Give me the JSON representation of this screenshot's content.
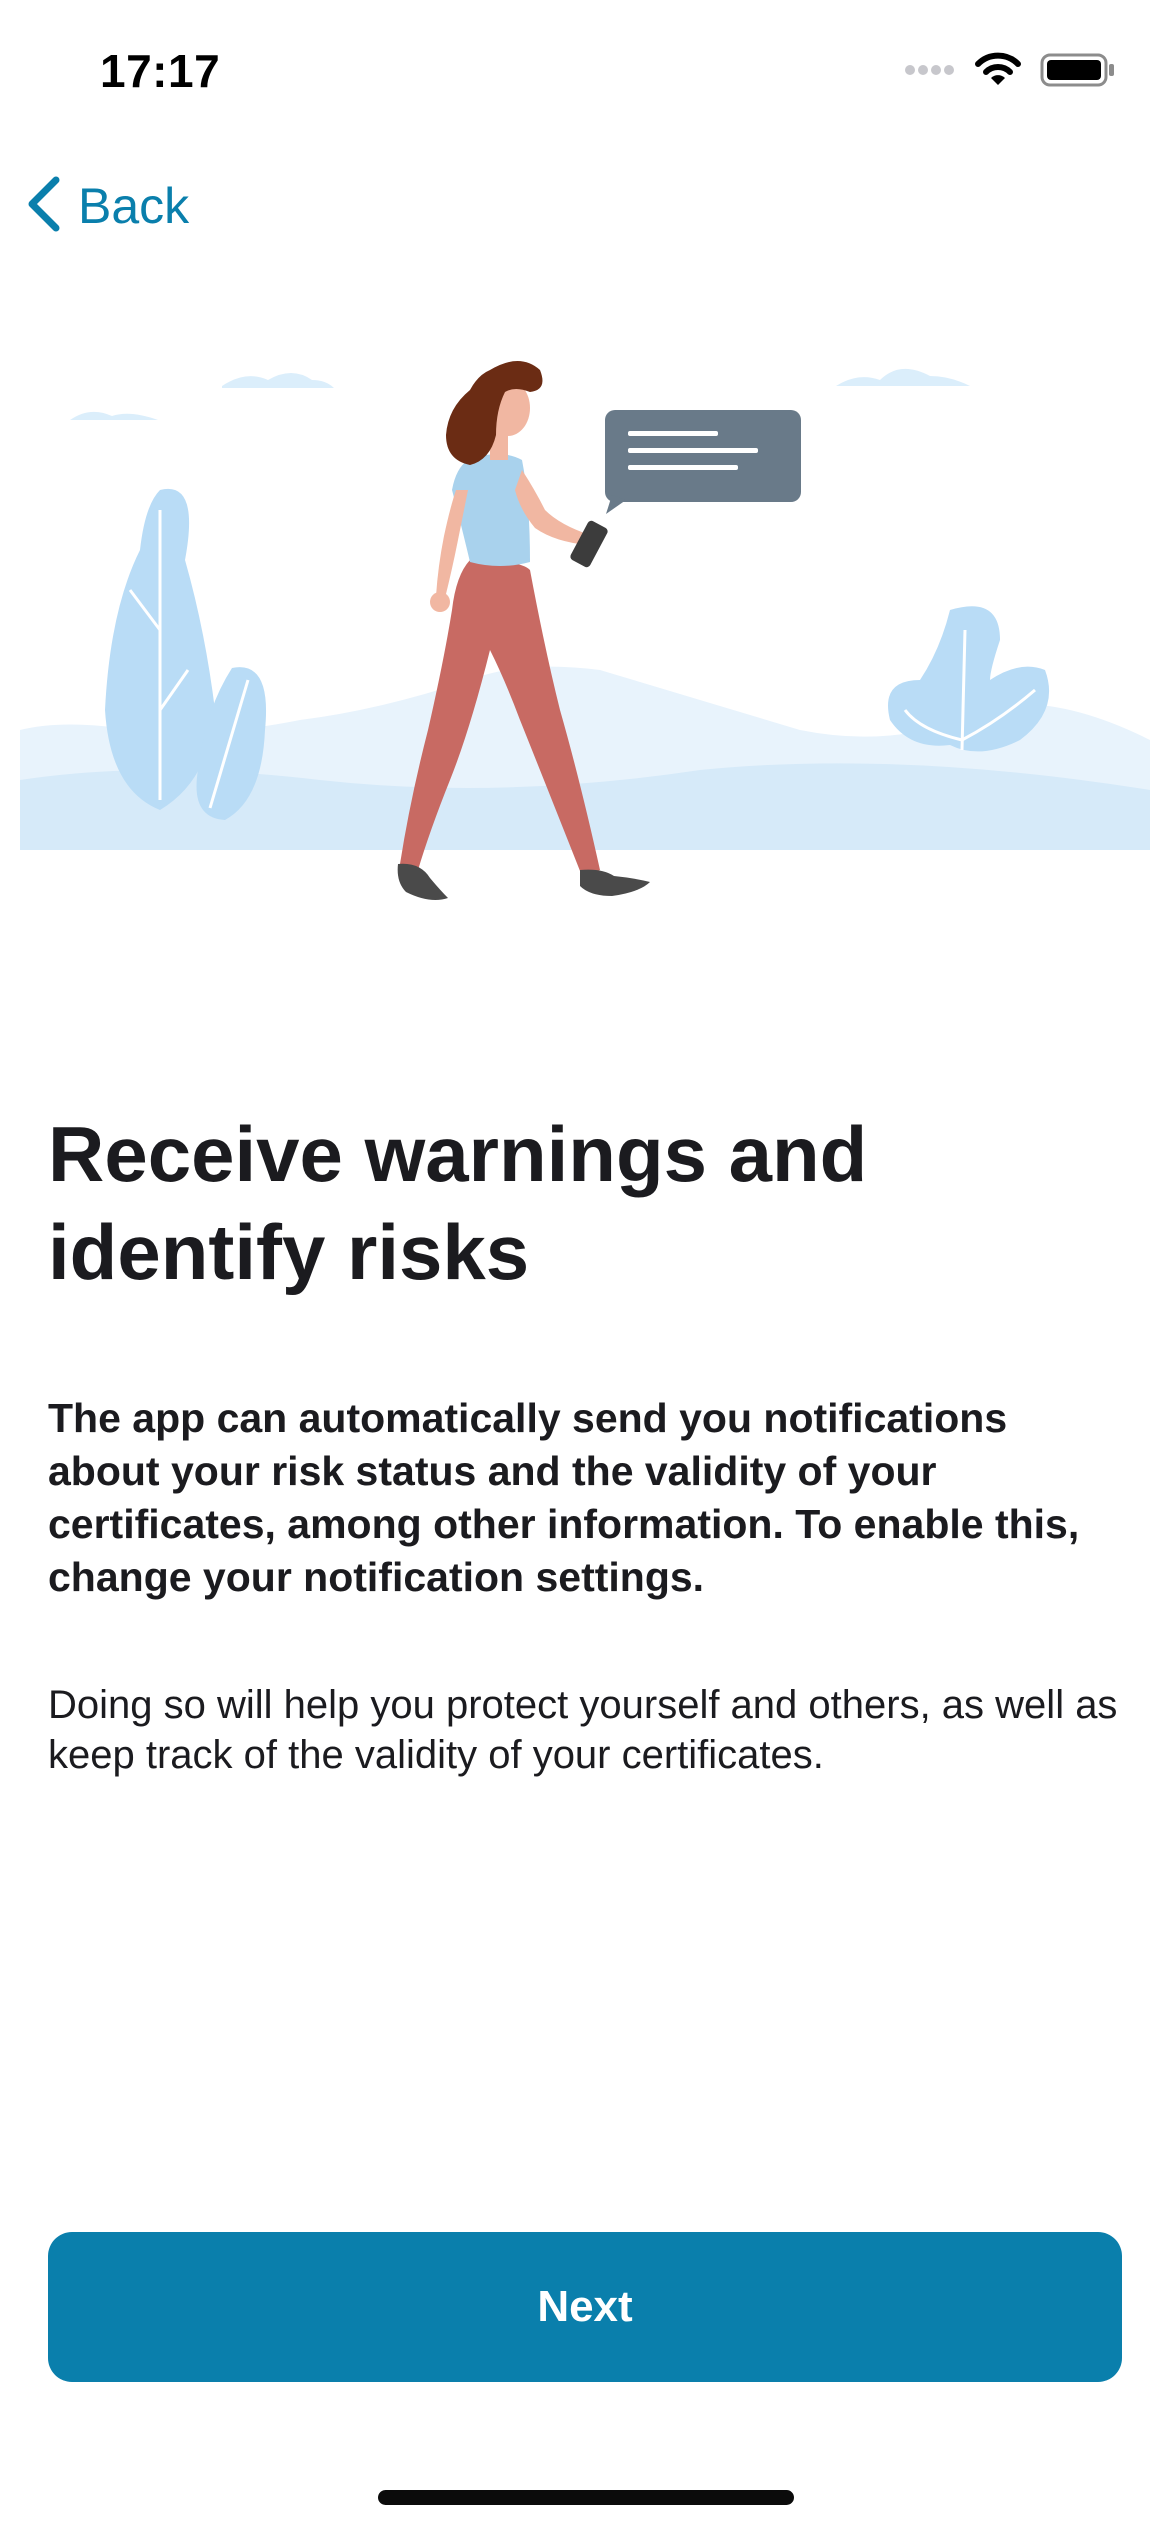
{
  "status_bar": {
    "time": "17:17",
    "icons": [
      "cellular-signal-icon",
      "wifi-icon",
      "battery-icon"
    ]
  },
  "nav": {
    "back_label": "Back",
    "back_icon": "chevron-left-icon"
  },
  "illustration": {
    "icon": "person-with-phone-illustration"
  },
  "content": {
    "title": "Receive warnings and identify risks",
    "lead": "The app can automatically send you notifications about your risk status and the validity of your certificates, among other information. To enable this, change your notification settings.",
    "body": "Doing so will help you protect yourself and others, as well as keep track of the validity of your certificates."
  },
  "actions": {
    "next_label": "Next"
  },
  "colors": {
    "accent": "#0a7fac",
    "text": "#1b1b1f",
    "background": "#ffffff"
  }
}
